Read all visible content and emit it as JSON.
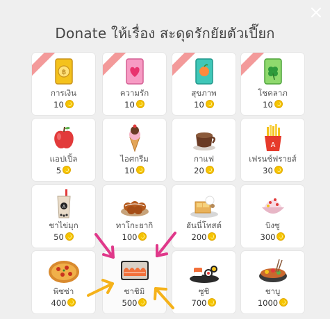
{
  "dialog": {
    "title": "Donate ให้เรื่อง สะดุดรักยัยตัวเปี๊ยก",
    "close_icon": "close-icon"
  },
  "items": [
    {
      "name": "การเงิน",
      "price": "10",
      "ribbon": true,
      "icon": "gold-card-icon"
    },
    {
      "name": "ความรัก",
      "price": "10",
      "ribbon": true,
      "icon": "heart-card-icon"
    },
    {
      "name": "สุขภาพ",
      "price": "10",
      "ribbon": true,
      "icon": "health-card-icon"
    },
    {
      "name": "โชคลาภ",
      "price": "10",
      "ribbon": true,
      "icon": "clover-card-icon"
    },
    {
      "name": "แอปเปิ้ล",
      "price": "5",
      "ribbon": false,
      "icon": "apple-icon"
    },
    {
      "name": "ไอศกรีม",
      "price": "10",
      "ribbon": false,
      "icon": "ice-cream-icon"
    },
    {
      "name": "กาแฟ",
      "price": "20",
      "ribbon": false,
      "icon": "coffee-icon"
    },
    {
      "name": "เฟรนช์ฟรายส์",
      "price": "30",
      "ribbon": false,
      "icon": "french-fries-icon"
    },
    {
      "name": "ชาไข่มุก",
      "price": "50",
      "ribbon": false,
      "icon": "bubble-tea-icon"
    },
    {
      "name": "ทาโกะยากิ",
      "price": "100",
      "ribbon": false,
      "icon": "takoyaki-icon"
    },
    {
      "name": "ฮันนี่โทสต์",
      "price": "200",
      "ribbon": false,
      "icon": "honey-toast-icon"
    },
    {
      "name": "บิงซู",
      "price": "300",
      "ribbon": false,
      "icon": "bingsu-icon"
    },
    {
      "name": "พิซซ่า",
      "price": "400",
      "ribbon": false,
      "icon": "pizza-icon"
    },
    {
      "name": "ซาชิมิ",
      "price": "500",
      "ribbon": false,
      "icon": "sashimi-icon"
    },
    {
      "name": "ซูชิ",
      "price": "700",
      "ribbon": false,
      "icon": "sushi-icon"
    },
    {
      "name": "ชาบู",
      "price": "1000",
      "ribbon": false,
      "icon": "shabu-icon"
    }
  ],
  "colors": {
    "pink_arrow": "#e0388a",
    "yellow_arrow": "#f5b21a",
    "ribbon": "#f39a9a",
    "coin": "#f5c400"
  }
}
